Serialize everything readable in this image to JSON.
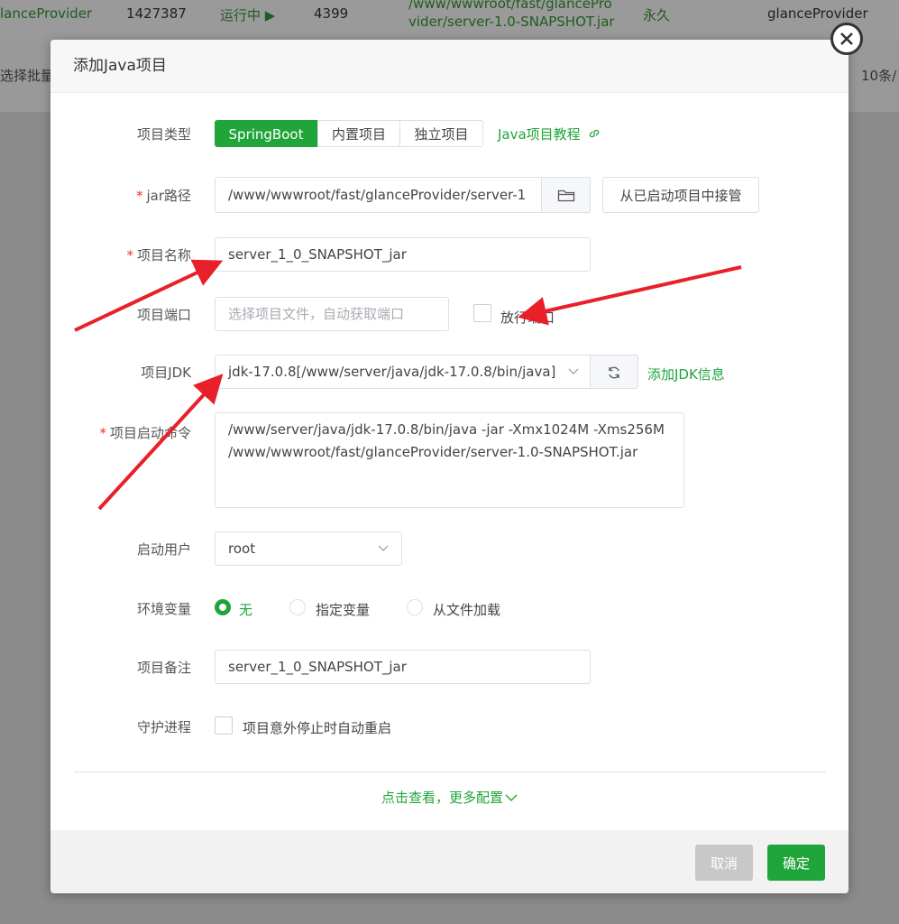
{
  "background": {
    "row1": {
      "name": "lanceProvider",
      "pid": "1427387",
      "status": "运行中 ▶",
      "port": "4399",
      "path_line1": "/www/wwwroot/fast/glancePro",
      "path_line2": "vider/server-1.0-SNAPSHOT.jar",
      "expire": "永久",
      "remark": "glanceProvider"
    },
    "row2": {
      "batch": "选择批量",
      "page_size": "10条/"
    }
  },
  "modal": {
    "title": "添加Java项目",
    "close_icon": "close-icon",
    "project_type": {
      "label": "项目类型",
      "options": [
        "SpringBoot",
        "内置项目",
        "独立项目"
      ],
      "selected": "SpringBoot",
      "tutorial_link": "Java项目教程"
    },
    "jar_path": {
      "label": "jar路径",
      "value": "/www/wwwroot/fast/glanceProvider/server-1",
      "take_over_button": "从已启动项目中接管"
    },
    "project_name": {
      "label": "项目名称",
      "value": "server_1_0_SNAPSHOT_jar"
    },
    "project_port": {
      "label": "项目端口",
      "placeholder": "选择项目文件，自动获取端口",
      "open_port_label": "放行端口"
    },
    "project_jdk": {
      "label": "项目JDK",
      "value": "jdk-17.0.8[/www/server/java/jdk-17.0.8/bin/java]",
      "add_jdk_link": "添加JDK信息"
    },
    "start_command": {
      "label": "项目启动命令",
      "value": "/www/server/java/jdk-17.0.8/bin/java -jar  -Xmx1024M -Xms256M /www/wwwroot/fast/glanceProvider/server-1.0-SNAPSHOT.jar"
    },
    "start_user": {
      "label": "启动用户",
      "value": "root"
    },
    "env_vars": {
      "label": "环境变量",
      "options": [
        "无",
        "指定变量",
        "从文件加载"
      ],
      "selected": "无"
    },
    "remark": {
      "label": "项目备注",
      "value": "server_1_0_SNAPSHOT_jar"
    },
    "daemon": {
      "label": "守护进程",
      "checkbox_label": "项目意外停止时自动重启"
    },
    "more_config": "点击查看，更多配置",
    "cancel_button": "取消",
    "confirm_button": "确定"
  },
  "colors": {
    "accent": "#20a53a",
    "annotation_arrow": "#e8202a",
    "required": "#ef2f2f"
  }
}
